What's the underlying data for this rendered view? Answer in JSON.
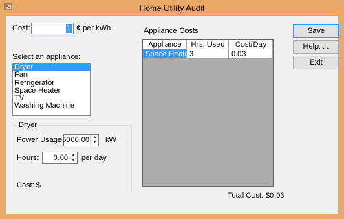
{
  "window": {
    "title": "Home Utility Audit"
  },
  "cost": {
    "label": "Cost:",
    "value": "1",
    "unit": "¢ per kWh"
  },
  "appliance_list": {
    "label": "Select an appliance:",
    "items": [
      "Dryer",
      "Fan",
      "Refrigerator",
      "Space Heater",
      "TV",
      "Washing Machine"
    ],
    "selected_index": 0
  },
  "details": {
    "group_title": "Dryer",
    "power_label": "Power Usage:",
    "power_value": "5000.00",
    "power_unit": "kW",
    "hours_label": "Hours:",
    "hours_value": "0.00",
    "hours_unit": "per day",
    "cost_label": "Cost: $"
  },
  "costs_table": {
    "title": "Appliance Costs",
    "columns": [
      "Appliance",
      "Hrs. Used",
      "Cost/Day"
    ],
    "rows": [
      [
        "Space Heater",
        "3",
        "0.03"
      ]
    ],
    "total_label": "Total Cost: $0.03"
  },
  "buttons": {
    "save": "Save",
    "help": "Help. . .",
    "exit": "Exit"
  },
  "colors": {
    "frame": "#e9a865",
    "selection": "#3399ff",
    "grid_bg": "#ababab"
  }
}
